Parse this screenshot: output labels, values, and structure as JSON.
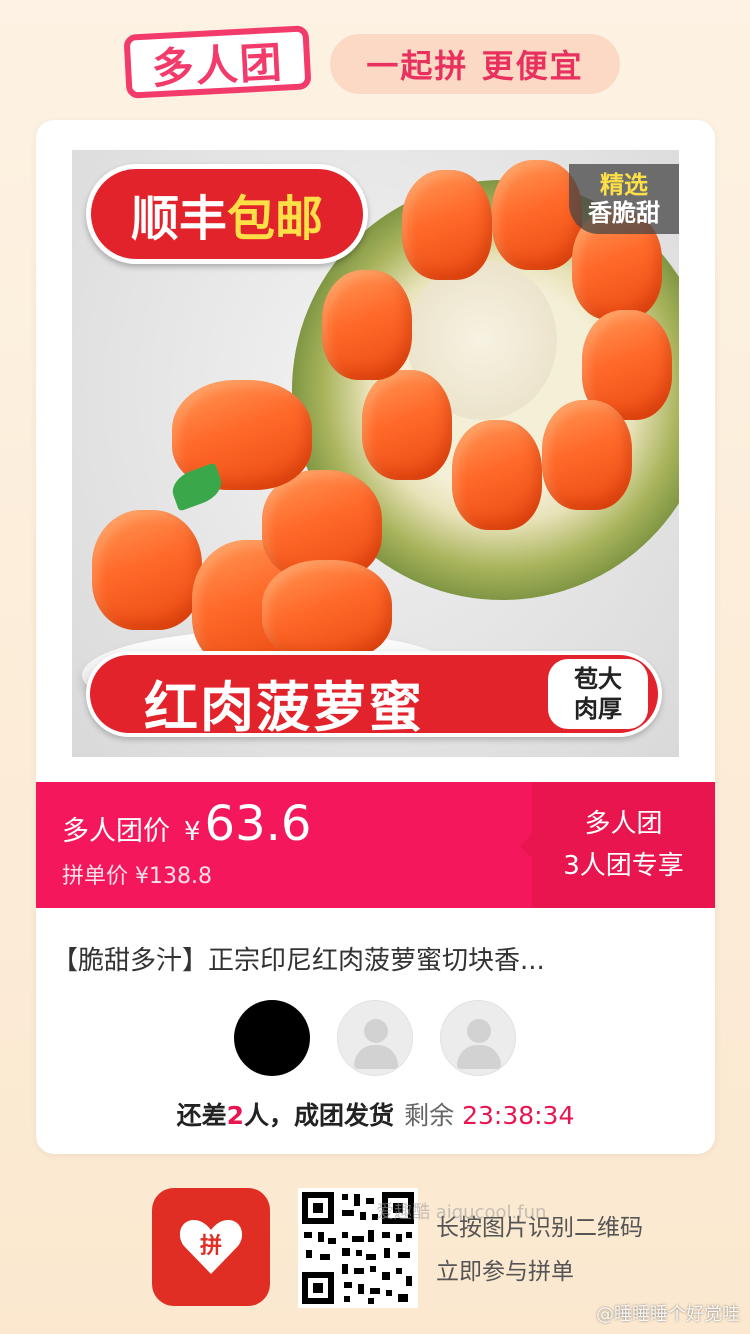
{
  "header": {
    "logo_text": "多人团",
    "slogan": "一起拼 更便宜"
  },
  "product_image": {
    "shipping_badge_part1": "顺丰",
    "shipping_badge_part2": "包邮",
    "select_tag_line1": "精选",
    "select_tag_line2": "香脆甜",
    "name_banner": "红肉菠萝蜜",
    "side_line1": "苞大",
    "side_line2": "肉厚"
  },
  "price": {
    "label": "多人团价",
    "currency": "¥",
    "value": "63.6",
    "original_label": "拼单价",
    "original_price": "¥138.8",
    "group_type": "多人团",
    "group_size": "3人团专享"
  },
  "product_title": "【脆甜多汁】正宗印尼红肉菠萝蜜切块香...",
  "status": {
    "prefix": "还差",
    "count": "2",
    "suffix": "人，成团发货",
    "remaining_label": "剩余",
    "timer": "23:38:34"
  },
  "footer": {
    "line1": "长按图片识别二维码",
    "line2": "立即参与拼单",
    "app_icon_text": "拼",
    "watermark": "爱趣酷 aiqucool.fun",
    "weibo": "@睡睡睡个好觉哇"
  },
  "colors": {
    "brand_pink": "#f5175c",
    "pinduoduo_red": "#e02e24"
  }
}
